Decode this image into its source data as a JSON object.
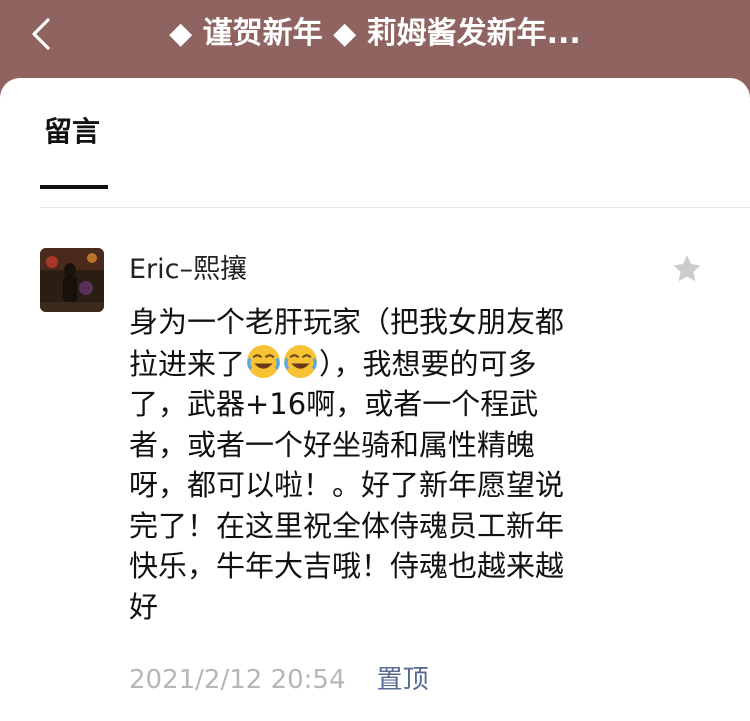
{
  "header": {
    "title": "◆ 谨贺新年 ◆ 莉姆酱发新年...",
    "back_icon": "chevron-left-icon"
  },
  "tabs": [
    {
      "label": "留言",
      "active": true
    }
  ],
  "comment": {
    "username": "Eric–熙攘",
    "avatar_icon": "avatar-photo",
    "star_icon": "star-icon",
    "lines": {
      "l1": "身为一个老肝玩家（把我女朋友都",
      "l2a": "拉进来了",
      "l2b": "），我想要的可多",
      "l3": "了，武器+16啊，或者一个程武",
      "l4": "者，或者一个好坐骑和属性精魄",
      "l5": "呀，都可以啦！。好了新年愿望说",
      "l6": "完了！在这里祝全体侍魂员工新年",
      "l7": "快乐，牛年大吉哦！侍魂也越来越",
      "l8": "好"
    },
    "emoji_icon": "face-with-tears-of-joy-icon",
    "timestamp": "2021/2/12 20:54",
    "pin_label": "置顶"
  },
  "colors": {
    "header_bg": "#8e6360",
    "link": "#576b95",
    "timestamp": "#b6b6b6",
    "star": "#cccccc"
  }
}
